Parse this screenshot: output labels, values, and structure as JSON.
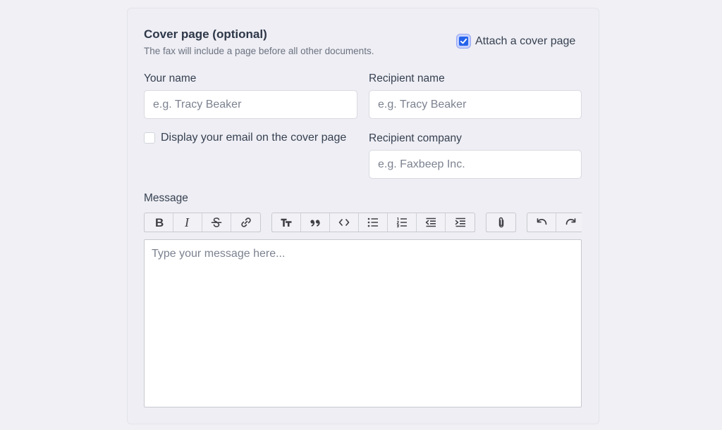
{
  "cover": {
    "title": "Cover page (optional)",
    "description": "The fax will include a page before all other documents.",
    "attach_label": "Attach a cover page",
    "attach_checked": true
  },
  "fields": {
    "your_name": {
      "label": "Your name",
      "placeholder": "e.g. Tracy Beaker"
    },
    "recipient_name": {
      "label": "Recipient name",
      "placeholder": "e.g. Tracy Beaker"
    },
    "recipient_company": {
      "label": "Recipient company",
      "placeholder": "e.g. Faxbeep Inc."
    },
    "display_email": {
      "label": "Display your email on the cover page",
      "checked": false
    }
  },
  "message": {
    "label": "Message",
    "placeholder": "Type your message here..."
  },
  "toolbar": {
    "groups": [
      [
        "bold-icon",
        "italic-icon",
        "strikethrough-icon",
        "link-icon"
      ],
      [
        "heading-icon",
        "quote-icon",
        "code-icon",
        "bullet-list-icon",
        "numbered-list-icon",
        "outdent-icon",
        "indent-icon"
      ],
      [
        "attach-file-icon"
      ],
      [
        "undo-icon",
        "redo-icon"
      ]
    ]
  },
  "colors": {
    "accent": "#2563eb",
    "background": "#f0f0f5"
  }
}
